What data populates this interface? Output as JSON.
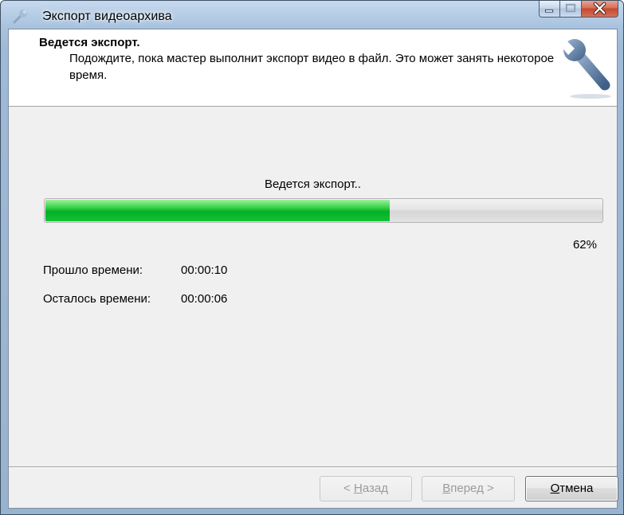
{
  "window": {
    "title": "Экспорт видеоархива",
    "caption_buttons": [
      "minimize-icon",
      "maximize-icon",
      "close-icon"
    ]
  },
  "header": {
    "title": "Ведется экспорт.",
    "description": "Подождите, пока мастер выполнит экспорт видео в файл. Это может занять некоторое время.",
    "icon": "wrench-icon"
  },
  "progress": {
    "status_text": "Ведется экспорт..",
    "percent_label": "62%",
    "value": 0.62,
    "fill_color": "#06b025"
  },
  "times": {
    "elapsed_label": "Прошло времени:",
    "elapsed_value": "00:00:10",
    "remaining_label": "Осталось времени:",
    "remaining_value": "00:00:06"
  },
  "buttons": {
    "back": {
      "prefix": "< ",
      "accel": "Н",
      "rest": "азад",
      "enabled": false
    },
    "next": {
      "accel": "В",
      "rest": "перед",
      "suffix": " >",
      "enabled": false
    },
    "cancel": {
      "accel": "О",
      "rest": "тмена",
      "enabled": true
    }
  },
  "colors": {
    "titlebar": "#a9c3df",
    "close_button": "#c4482e",
    "progress_fill": "#06b025"
  }
}
